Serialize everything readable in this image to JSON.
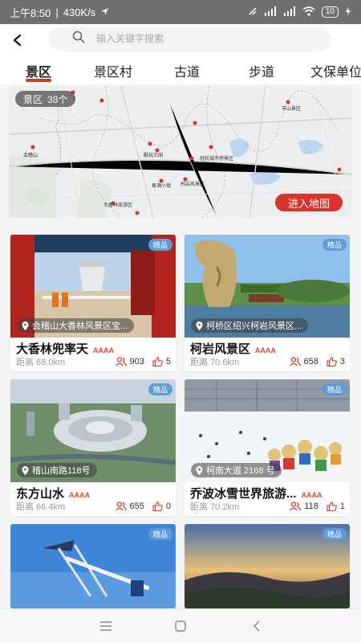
{
  "status": {
    "time": "上午8:50",
    "speed": "430K/s",
    "signal1": "HD",
    "signal2": "HD",
    "battery": "10"
  },
  "search": {
    "placeholder": "输入关键字搜索"
  },
  "tabs": [
    {
      "label": "景区",
      "active": true
    },
    {
      "label": "景区村",
      "active": false
    },
    {
      "label": "古道",
      "active": false
    },
    {
      "label": "步道",
      "active": false
    },
    {
      "label": "文保单位",
      "active": false
    }
  ],
  "map": {
    "badge_label": "景区",
    "badge_count": "38个",
    "button_label": "进入地图",
    "pins": [
      "羊山景区",
      "酷玩王国",
      "会稽山",
      "黄酒小镇",
      "轻纺城市场景区",
      "柯岩风景区",
      "大香林旅游区"
    ]
  },
  "cards": [
    {
      "badge": "精品",
      "location": "会稽山大香林风景区宝...",
      "name": "大香林兜率天",
      "rating": "AAAA",
      "distance": "距离 68.0km",
      "followers": "903",
      "likes": "5"
    },
    {
      "badge": "精品",
      "location": "柯桥区绍兴柯岩风景区...",
      "name": "柯岩风景区",
      "rating": "AAAA",
      "distance": "距离 70.6km",
      "followers": "658",
      "likes": "3"
    },
    {
      "badge": "精品",
      "location": "稽山南路118号",
      "name": "东方山水",
      "rating": "AAAA",
      "distance": "距离 66.4km",
      "followers": "655",
      "likes": "0"
    },
    {
      "badge": "精品",
      "location": "柯南大道 2168 号",
      "name": "乔波冰雪世界旅游...",
      "rating": "AAAA",
      "distance": "距离 70.2km",
      "followers": "118",
      "likes": "1"
    },
    {
      "badge": "精品"
    },
    {
      "badge": "精品"
    }
  ],
  "colors": {
    "accent": "#d9342b",
    "premium": "#5f9bd8",
    "rating": "#e0463c"
  }
}
